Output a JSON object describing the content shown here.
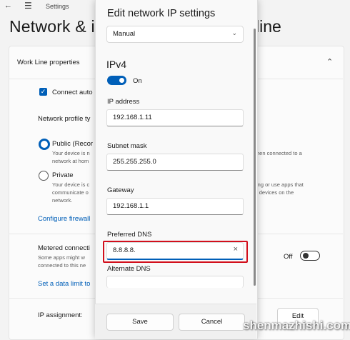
{
  "app": {
    "title": "Settings",
    "page_title_left": "Network & in",
    "page_title_right": "line"
  },
  "background": {
    "section_title": "Work Line properties",
    "connect_auto": "Connect auto",
    "network_profile_label": "Network profile ty",
    "public_label": "Public (Recor",
    "public_desc_1": "Your device is n",
    "public_desc_2": "network at hom",
    "public_desc_right_1": "hen connected to a",
    "private_label": "Private",
    "private_desc_1": "Your device is c",
    "private_desc_2": "communicate o",
    "private_desc_3": "network.",
    "private_desc_right_1": "ing or use apps that",
    "private_desc_right_2": "l devices on the",
    "firewall_link": "Configure firewall",
    "metered_label": "Metered connecti",
    "metered_desc_1": "Some apps might w",
    "metered_desc_2": "connected to this ne",
    "metered_state": "Off",
    "data_limit_link": "Set a data limit to",
    "ip_assignment_label": "IP assignment:",
    "edit_button": "Edit"
  },
  "dialog": {
    "title": "Edit network IP settings",
    "mode_selected": "Manual",
    "ipv4_heading": "IPv4",
    "ipv4_toggle_state": "On",
    "fields": {
      "ip_address": {
        "label": "IP address",
        "value": "192.168.1.11"
      },
      "subnet_mask": {
        "label": "Subnet mask",
        "value": "255.255.255.0"
      },
      "gateway": {
        "label": "Gateway",
        "value": "192.168.1.1"
      },
      "preferred_dns": {
        "label": "Preferred DNS",
        "value": "8.8.8.8."
      },
      "alternate_dns": {
        "label": "Alternate DNS",
        "value": ""
      }
    },
    "save_button": "Save",
    "cancel_button": "Cancel"
  },
  "watermark": "shenmazhishi.com",
  "colors": {
    "accent": "#005fb8",
    "highlight_box": "#d20f1c"
  }
}
